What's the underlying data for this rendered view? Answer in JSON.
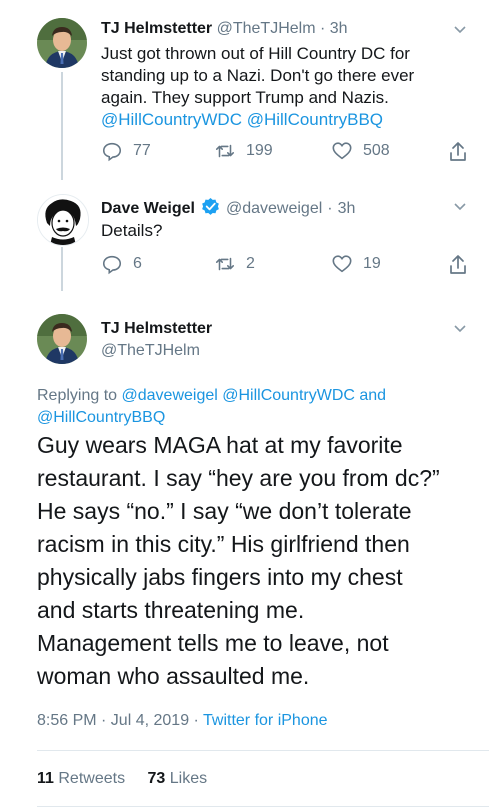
{
  "tweet1": {
    "name": "TJ Helmstetter",
    "handle": "@TheTJHelm",
    "time": "3h",
    "lines": [
      "Just got thrown out of Hill Country DC for",
      "standing up to a Nazi. Don't go there ever",
      "again. They support Trump and Nazis."
    ],
    "mentions": "@HillCountryWDC @HillCountryBBQ",
    "replies": "77",
    "retweets": "199",
    "likes": "508"
  },
  "tweet2": {
    "name": "Dave Weigel",
    "handle": "@daveweigel",
    "time": "3h",
    "text": "Details?",
    "replies": "6",
    "retweets": "2",
    "likes": "19"
  },
  "main": {
    "name": "TJ Helmstetter",
    "handle": "@TheTJHelm",
    "replying_prefix": "Replying to",
    "replying_line1": "@daveweigel @HillCountryWDC and",
    "replying_line2": "@HillCountryBBQ",
    "lines": [
      "Guy wears MAGA hat at my favorite",
      "restaurant. I say “hey are you from dc?”",
      "He says “no.” I say “we don’t tolerate",
      "racism in this city.” His girlfriend then",
      "physically jabs fingers into my chest",
      "and starts threatening me.",
      "Management tells me to leave, not",
      "woman who assaulted me."
    ],
    "timestamp": "8:56 PM · Jul 4, 2019 · ",
    "source": "Twitter for iPhone",
    "retweets_count": "11",
    "retweets_label": "Retweets",
    "likes_count": "73",
    "likes_label": "Likes"
  },
  "colors": {
    "link": "#1b95e0",
    "muted": "#657786",
    "verified": "#1da1f2"
  }
}
